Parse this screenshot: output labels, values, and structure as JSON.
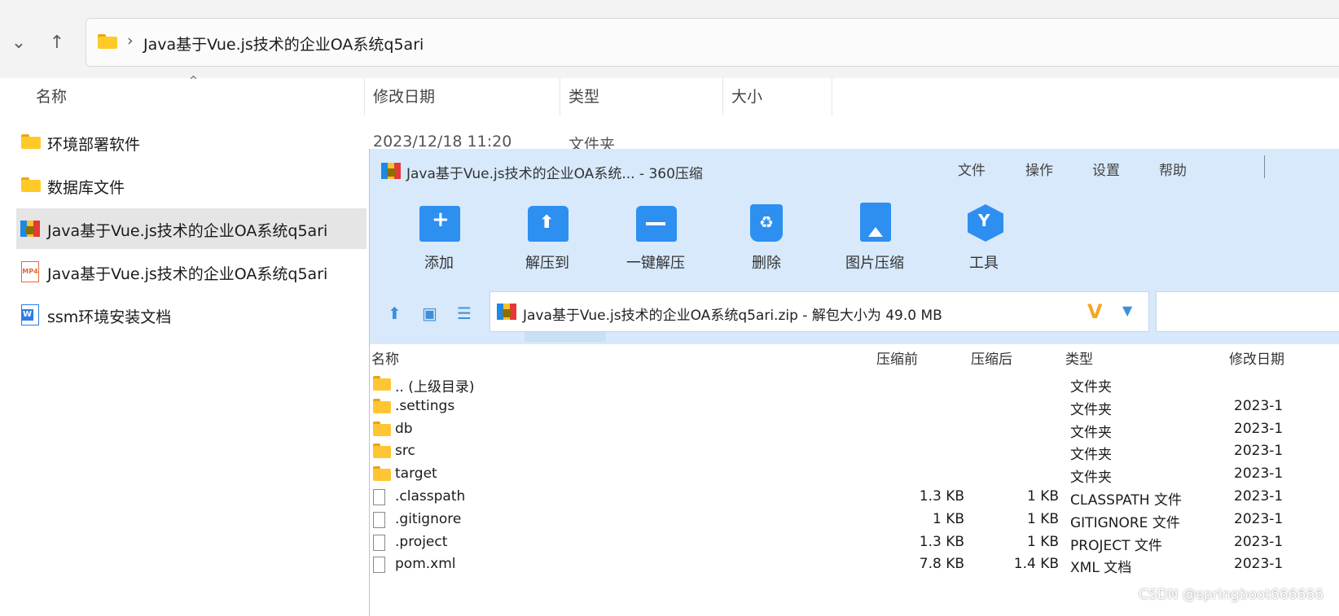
{
  "explorer": {
    "path": "Java基于Vue.js技术的企业OA系统q5ari",
    "columns": {
      "name": "名称",
      "modified": "修改日期",
      "type": "类型",
      "size": "大小"
    },
    "first_row_meta": {
      "modified": "2023/12/18 11:20",
      "type": "文件夹"
    },
    "items": [
      {
        "label": "环境部署软件",
        "icon": "folder-icon"
      },
      {
        "label": "数据库文件",
        "icon": "folder-icon"
      },
      {
        "label": "Java基于Vue.js技术的企业OA系统q5ari",
        "icon": "zip-archive-icon",
        "selected": true
      },
      {
        "label": "Java基于Vue.js技术的企业OA系统q5ari",
        "icon": "mp4-video-icon"
      },
      {
        "label": "ssm环境安装文档",
        "icon": "word-document-icon"
      }
    ]
  },
  "zip_window": {
    "title": "Java基于Vue.js技术的企业OA系统... - 360压缩",
    "menu": [
      "文件",
      "操作",
      "设置",
      "帮助"
    ],
    "tools": [
      {
        "label": "添加",
        "icon": "add-icon"
      },
      {
        "label": "解压到",
        "icon": "extract-to-icon"
      },
      {
        "label": "一键解压",
        "icon": "one-click-extract-icon"
      },
      {
        "label": "删除",
        "icon": "delete-icon"
      },
      {
        "label": "图片压缩",
        "icon": "image-compress-icon"
      },
      {
        "label": "工具",
        "icon": "tools-icon"
      }
    ],
    "archive_path": "Java基于Vue.js技术的企业OA系统q5ari.zip - 解包大小为 49.0 MB",
    "columns": {
      "name": "名称",
      "before": "压缩前",
      "after": "压缩后",
      "type": "类型",
      "modified": "修改日期"
    },
    "rows": [
      {
        "name": ".. (上级目录)",
        "icon": "folder-icon",
        "before": "",
        "after": "",
        "type": "文件夹",
        "modified": ""
      },
      {
        "name": ".settings",
        "icon": "folder-icon",
        "before": "",
        "after": "",
        "type": "文件夹",
        "modified": "2023-1"
      },
      {
        "name": "db",
        "icon": "folder-icon",
        "before": "",
        "after": "",
        "type": "文件夹",
        "modified": "2023-1"
      },
      {
        "name": "src",
        "icon": "folder-icon",
        "before": "",
        "after": "",
        "type": "文件夹",
        "modified": "2023-1"
      },
      {
        "name": "target",
        "icon": "folder-icon",
        "before": "",
        "after": "",
        "type": "文件夹",
        "modified": "2023-1"
      },
      {
        "name": ".classpath",
        "icon": "file-icon",
        "before": "1.3 KB",
        "after": "1 KB",
        "type": "CLASSPATH 文件",
        "modified": "2023-1"
      },
      {
        "name": ".gitignore",
        "icon": "file-icon",
        "before": "1 KB",
        "after": "1 KB",
        "type": "GITIGNORE 文件",
        "modified": "2023-1"
      },
      {
        "name": ".project",
        "icon": "file-icon",
        "before": "1.3 KB",
        "after": "1 KB",
        "type": "PROJECT 文件",
        "modified": "2023-1"
      },
      {
        "name": "pom.xml",
        "icon": "file-icon",
        "before": "7.8 KB",
        "after": "1.4 KB",
        "type": "XML 文档",
        "modified": "2023-1"
      }
    ]
  },
  "watermark": "CSDN @springboot666666",
  "colors": {
    "accent_blue": "#2d8ff0",
    "window_bg": "#d7e9fb",
    "folder_yellow": "#ffca28"
  }
}
